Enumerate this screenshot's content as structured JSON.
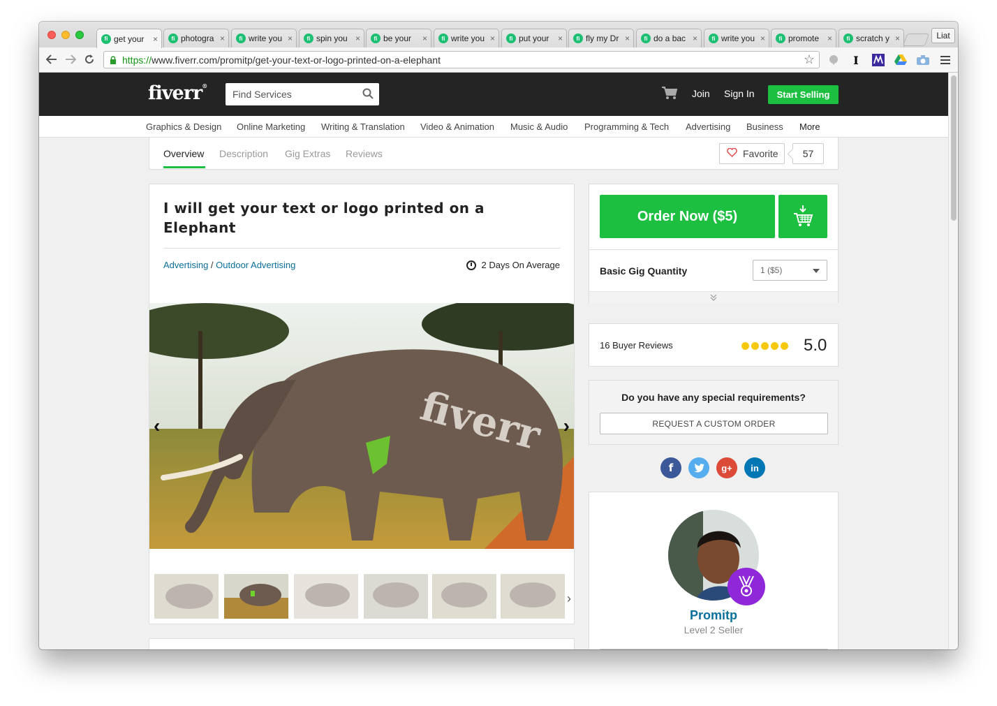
{
  "browser": {
    "tabs": [
      {
        "label": "get your"
      },
      {
        "label": "photogra"
      },
      {
        "label": "write you"
      },
      {
        "label": "spin you"
      },
      {
        "label": "be your"
      },
      {
        "label": "write you"
      },
      {
        "label": "put your"
      },
      {
        "label": "fly my Dr"
      },
      {
        "label": "do a bac"
      },
      {
        "label": "write you"
      },
      {
        "label": "promote"
      },
      {
        "label": "scratch y"
      }
    ],
    "tab_favicon": "fi",
    "tab_close": "×",
    "profile_label": "Liat",
    "url_scheme": "https://",
    "url_rest": "www.fiverr.com/promitp/get-your-text-or-logo-printed-on-a-elephant"
  },
  "header": {
    "logo": "fiverr",
    "logo_mark": "®",
    "search_placeholder": "Find Services",
    "join": "Join",
    "sign_in": "Sign In",
    "start_selling": "Start Selling"
  },
  "categories": [
    "Graphics & Design",
    "Online Marketing",
    "Writing & Translation",
    "Video & Animation",
    "Music & Audio",
    "Programming & Tech",
    "Advertising",
    "Business",
    "More"
  ],
  "subnav": {
    "tabs": [
      "Overview",
      "Description",
      "Gig Extras",
      "Reviews"
    ],
    "favorite_label": "Favorite",
    "favorite_count": "57"
  },
  "gig": {
    "title": "I will get your text or logo printed on a Elephant",
    "category": "Advertising",
    "separator": " / ",
    "subcategory": "Outdoor Advertising",
    "delivery": "2 Days On Average",
    "image_text": "fiverr"
  },
  "order": {
    "button_label": "Order Now ($5)",
    "quantity_label": "Basic Gig Quantity",
    "quantity_value": "1 ($5)"
  },
  "reviews": {
    "count_label": "16 Buyer Reviews",
    "rating": "5.0",
    "stars": 5
  },
  "custom": {
    "question": "Do you have any special requirements?",
    "button_label": "REQUEST A CUSTOM ORDER"
  },
  "social": {
    "facebook": "f",
    "twitter": "t",
    "google": "g+",
    "linkedin": "in"
  },
  "seller": {
    "name": "Promitp",
    "level": "Level 2 Seller"
  },
  "colors": {
    "accent_green": "#1dbf40",
    "link_blue": "#0a6f9c",
    "header_bg": "#242424",
    "star_yellow": "#f6c90e",
    "badge_purple": "#8e28d8"
  }
}
